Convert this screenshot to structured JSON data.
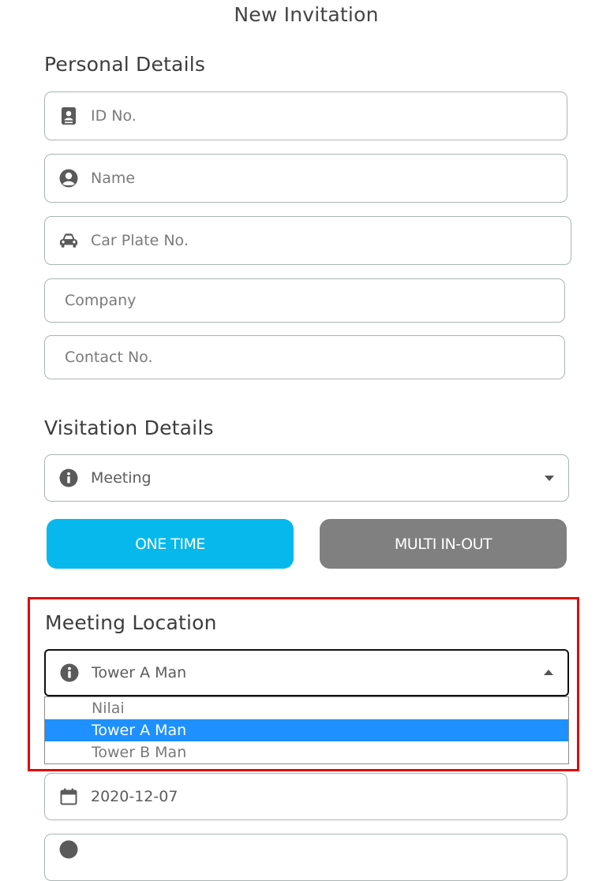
{
  "header": {
    "title": "New Invitation"
  },
  "personal_details": {
    "heading": "Personal Details",
    "id_no": {
      "placeholder": "ID No.",
      "icon": "id-card-icon"
    },
    "name": {
      "placeholder": "Name",
      "icon": "user-circle-icon"
    },
    "car_plate": {
      "placeholder": "Car Plate No.",
      "icon": "car-icon"
    },
    "company": {
      "placeholder": "Company"
    },
    "contact": {
      "placeholder": "Contact No."
    }
  },
  "visitation_details": {
    "heading": "Visitation Details",
    "purpose": {
      "value": "Meeting",
      "icon": "info-icon"
    },
    "entry_type": {
      "one_time": "ONE TIME",
      "multi": "MULTI IN-OUT",
      "selected": "ONE TIME",
      "active_color": "#06b8ec",
      "inactive_color": "#808080"
    }
  },
  "meeting_location": {
    "heading": "Meeting Location",
    "selected": "Tower A Man",
    "icon": "info-icon",
    "options": [
      "Nilai",
      "Tower A Man",
      "Tower B Man"
    ],
    "highlight_color": "#e8000d"
  },
  "date": {
    "value": "2020-12-07",
    "icon": "calendar-icon"
  }
}
